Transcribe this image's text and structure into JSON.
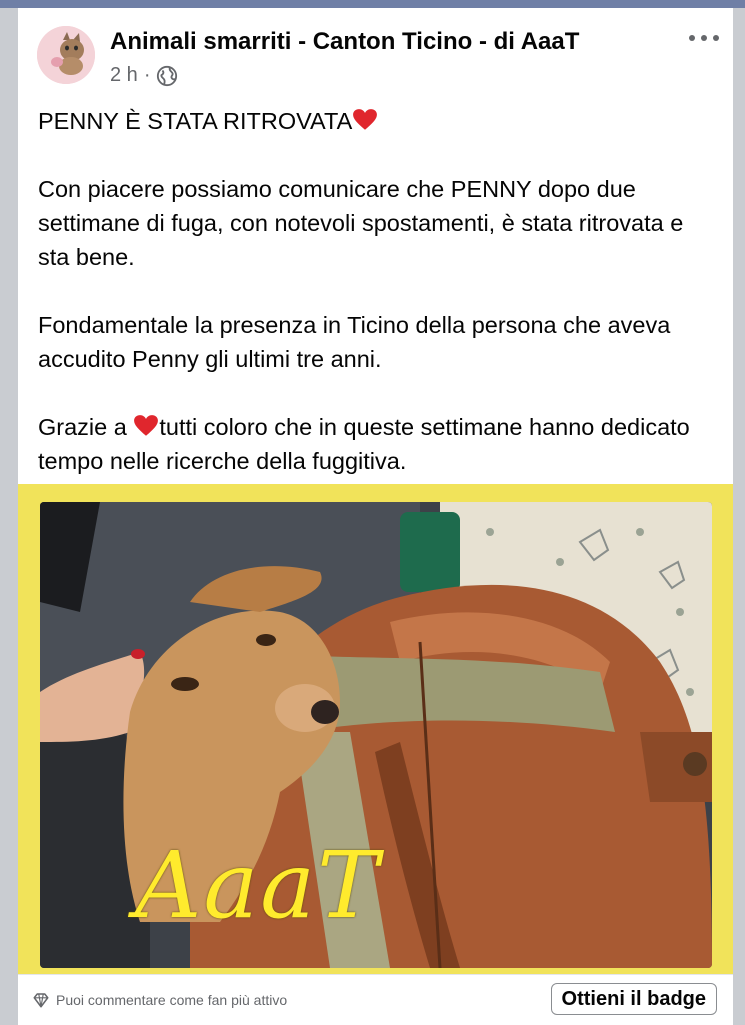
{
  "post": {
    "page_name": "Animali smarriti - Canton Ticino - di AaaT",
    "time": "2 h",
    "separator": "·",
    "visibility_icon": "globe-icon",
    "more_icon": "more-options-icon",
    "paragraphs": {
      "headline": "PENNY È STATA RITROVATA",
      "p1": "Con piacere possiamo comunicare che PENNY dopo due settimane di fuga, con notevoli spostamenti,  è stata ritrovata e sta bene.",
      "p2": "Fondamentale la presenza in Ticino della persona che aveva accudito Penny gli ultimi tre anni.",
      "p3_start": "Grazie a ",
      "p3_rest": "tutti coloro che in queste settimane hanno dedicato tempo nelle ricerche della fuggitiva."
    },
    "heart_emoji_icon": "red-heart-icon",
    "photo_watermark": "AaaT",
    "photo_frame_color": "#f1e35a"
  },
  "footer": {
    "hint": "Puoi commentare come fan più attivo",
    "hint_icon": "diamond-icon",
    "button_label": "Ottieni il badge"
  }
}
